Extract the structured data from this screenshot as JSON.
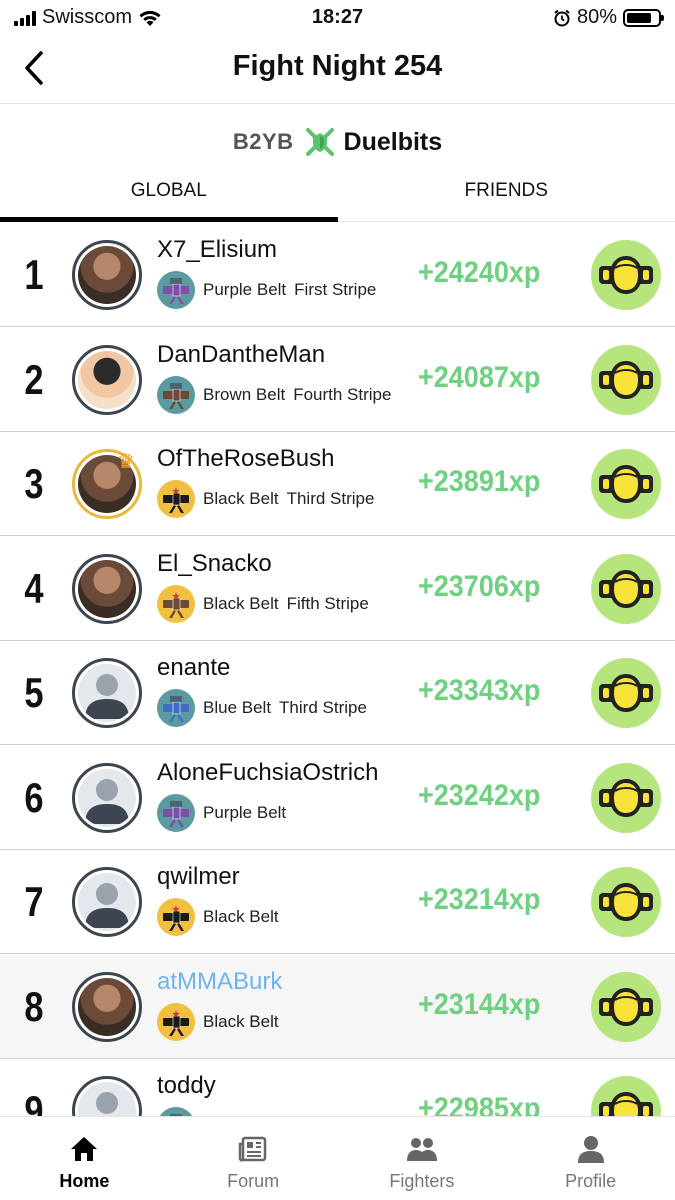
{
  "status_bar": {
    "carrier": "Swisscom",
    "time": "18:27",
    "battery": "80%",
    "battery_level": 0.8
  },
  "nav": {
    "title": "Fight Night 254",
    "back_icon": "chevron-left-icon"
  },
  "sponsor": {
    "prefix": "B2YB",
    "brand": "Duelbits",
    "brand_icon": "crossed-swords-shield-icon",
    "brand_color": "#5cc46f"
  },
  "tabs": [
    {
      "label": "GLOBAL",
      "active": true
    },
    {
      "label": "FRIENDS",
      "active": false
    }
  ],
  "colors": {
    "xp_green": "#6fd081",
    "trophy_bg": "#b6e57d",
    "trophy_yellow": "#f7e33a",
    "highlight_user": "#6fb5ec",
    "purple_belt": "#7d4fa8",
    "brown_belt": "#6d4a36",
    "black_belt": "#1a1a1a",
    "blue_belt": "#3f6ec4",
    "teal_badge": "#5b9aa0",
    "gold_badge": "#f1c040"
  },
  "leaderboard": [
    {
      "rank": "1",
      "username": "X7_Elisium",
      "belt": "Purple Belt",
      "stripe": "First Stripe",
      "xp": "+24240xp",
      "avatar": "photo",
      "belt_color": "purple",
      "badge": "teal"
    },
    {
      "rank": "2",
      "username": "DanDantheMan",
      "belt": "Brown Belt",
      "stripe": "Fourth Stripe",
      "xp": "+24087xp",
      "avatar": "cartoon",
      "belt_color": "brown",
      "badge": "teal"
    },
    {
      "rank": "3",
      "username": "OfTheRoseBush",
      "belt": "Black Belt",
      "stripe": "Third Stripe",
      "xp": "+23891xp",
      "avatar": "photo",
      "belt_color": "black",
      "badge": "gold",
      "crown": true
    },
    {
      "rank": "4",
      "username": "El_Snacko",
      "belt": "Black Belt",
      "stripe": "Fifth Stripe",
      "xp": "+23706xp",
      "avatar": "photo",
      "belt_color": "brown",
      "badge": "gold"
    },
    {
      "rank": "5",
      "username": "enante",
      "belt": "Blue Belt",
      "stripe": "Third Stripe",
      "xp": "+23343xp",
      "avatar": "placeholder",
      "belt_color": "blue",
      "badge": "teal"
    },
    {
      "rank": "6",
      "username": "AloneFuchsiaOstrich",
      "belt": "Purple Belt",
      "stripe": "",
      "xp": "+23242xp",
      "avatar": "placeholder",
      "belt_color": "purple",
      "badge": "teal"
    },
    {
      "rank": "7",
      "username": "qwilmer",
      "belt": "Black Belt",
      "stripe": "",
      "xp": "+23214xp",
      "avatar": "placeholder",
      "belt_color": "black",
      "badge": "gold"
    },
    {
      "rank": "8",
      "username": "atMMABurk",
      "belt": "Black Belt",
      "stripe": "",
      "xp": "+23144xp",
      "avatar": "photo",
      "belt_color": "black",
      "badge": "gold",
      "highlight": true
    },
    {
      "rank": "9",
      "username": "toddy",
      "belt": "",
      "stripe": "",
      "xp": "+22985xp",
      "avatar": "placeholder",
      "belt_color": "teal",
      "badge": "teal"
    }
  ],
  "bottom_nav": [
    {
      "label": "Home",
      "icon": "home-icon",
      "active": true
    },
    {
      "label": "Forum",
      "icon": "newspaper-icon",
      "active": false
    },
    {
      "label": "Fighters",
      "icon": "fighters-icon",
      "active": false
    },
    {
      "label": "Profile",
      "icon": "profile-icon",
      "active": false
    }
  ]
}
